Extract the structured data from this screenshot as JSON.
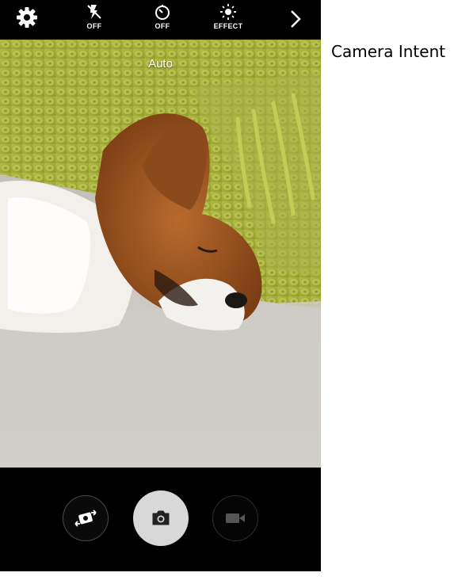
{
  "topbar": {
    "settings_icon": "gear-icon",
    "flash": {
      "icon": "flash-off-icon",
      "label": "OFF"
    },
    "timer": {
      "icon": "timer-icon",
      "label": "OFF"
    },
    "effect": {
      "icon": "effect-icon",
      "label": "EFFECT"
    },
    "more_icon": "chevron-right-icon"
  },
  "viewfinder": {
    "mode_label": "Auto",
    "scene": "sleeping papillon dog on grey couch with green knitted blanket"
  },
  "bottombar": {
    "switch_camera_icon": "switch-camera-icon",
    "shutter_icon": "camera-icon",
    "record_icon": "video-camera-icon"
  },
  "caption": "Camera Intent",
  "colors": {
    "bar_background": "#000000",
    "shutter": "#d8d8d8",
    "blanket": "#a9b43a"
  }
}
